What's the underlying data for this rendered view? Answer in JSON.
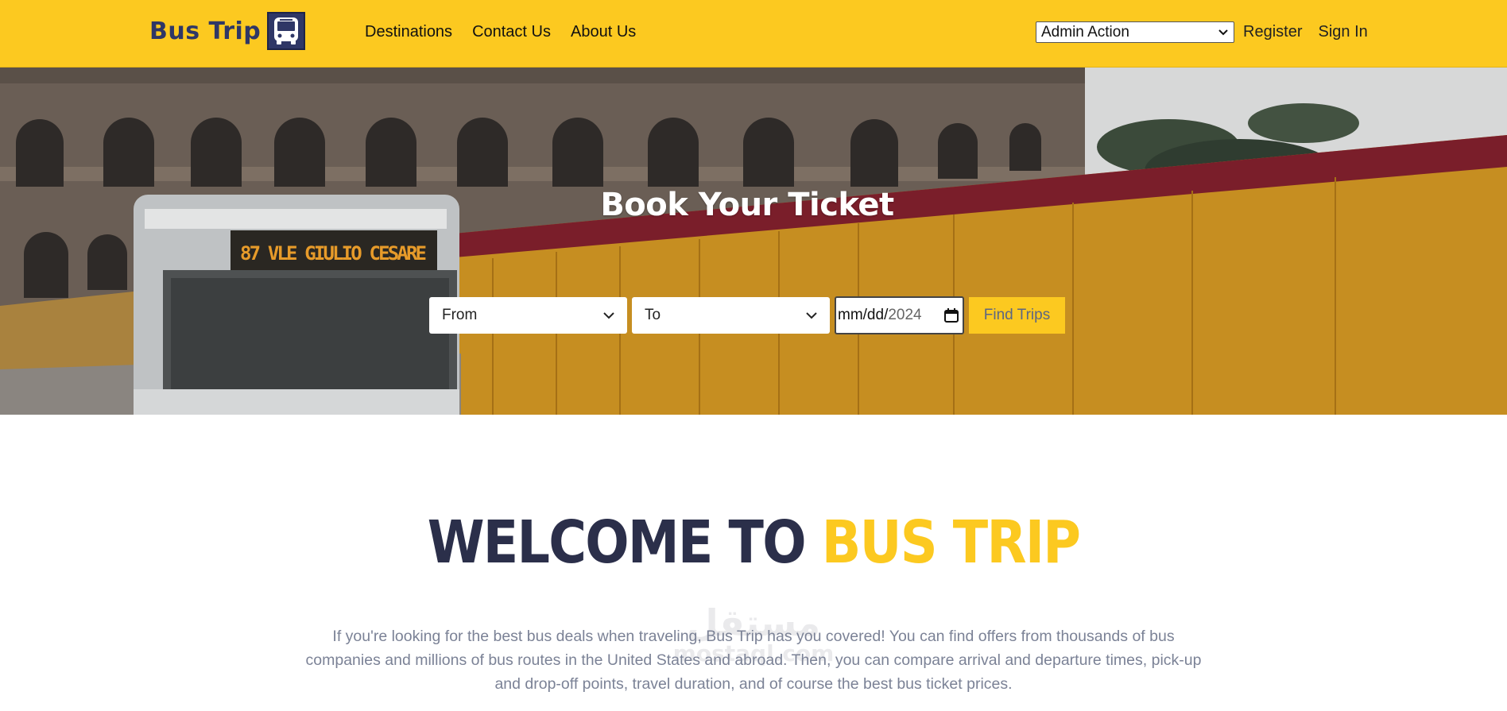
{
  "header": {
    "logo_text": "Bus Trip",
    "nav": [
      "Destinations",
      "Contact Us",
      "About Us"
    ],
    "admin_select_value": "Admin Action",
    "register_label": "Register",
    "signin_label": "Sign In",
    "colors": {
      "brand_yellow": "#fcc920",
      "brand_navy": "#2f3766"
    }
  },
  "hero": {
    "title": "Book Your Ticket",
    "bus_sign": "87 VLE GIULIO CESARE",
    "from_placeholder": "From",
    "to_placeholder": "To",
    "date_text": "mm/dd/",
    "date_year": "2024",
    "find_button": "Find Trips"
  },
  "welcome": {
    "title_part1": "WELCOME TO",
    "title_part2": "BUS TRIP",
    "paragraph": "If you're looking for the best bus deals when traveling, Bus Trip has you covered! You can find offers from thousands of bus companies and millions of bus routes in the United States and abroad. Then, you can compare arrival and departure times, pick-up and drop-off points, travel duration, and of course the best bus ticket prices."
  },
  "watermark": {
    "arabic": "مستقل",
    "latin": "mostaql.com"
  }
}
